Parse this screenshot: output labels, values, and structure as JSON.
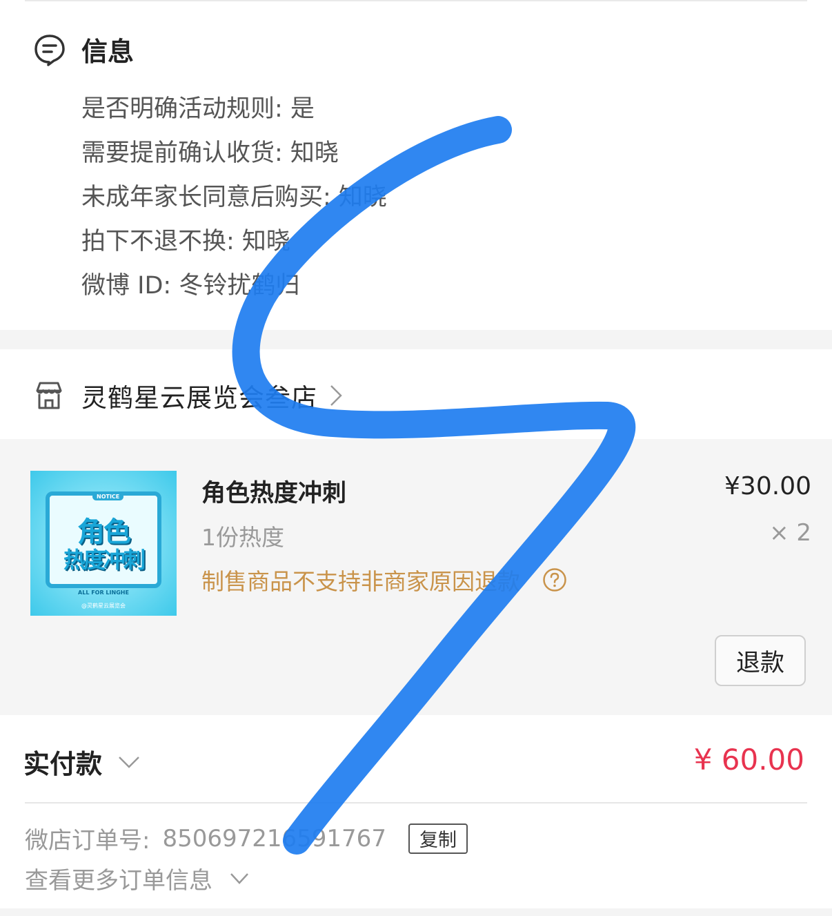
{
  "info": {
    "title": "信息",
    "lines": [
      "是否明确活动规则: 是",
      "需要提前确认收货: 知晓",
      "未成年家长同意后购买: 知晓",
      "拍下不退不换: 知晓",
      "微博 ID: 冬铃扰鹤归"
    ]
  },
  "store": {
    "name": "灵鹤星云展览会叁店"
  },
  "product": {
    "name": "角色热度冲刺",
    "spec": "1份热度",
    "note": "制售商品不支持非商家原因退款",
    "price": "¥30.00",
    "qty": "× 2",
    "refund_label": "退款",
    "thumbnail": {
      "notice": "NOTICE",
      "line1": "角色",
      "line2": "热度冲刺",
      "footer": "ALL FOR LINGHE",
      "credit": "@灵鹤星云展览会"
    }
  },
  "payment": {
    "label": "实付款",
    "amount": "¥ 60.00"
  },
  "order": {
    "number_label": "微店订单号:",
    "number": "850697216591767",
    "copy_label": "复制",
    "more_label": "查看更多订单信息"
  },
  "colors": {
    "accent_red": "#e8334f",
    "note_orange": "#c9934a",
    "scribble_blue": "#1e7df0"
  }
}
